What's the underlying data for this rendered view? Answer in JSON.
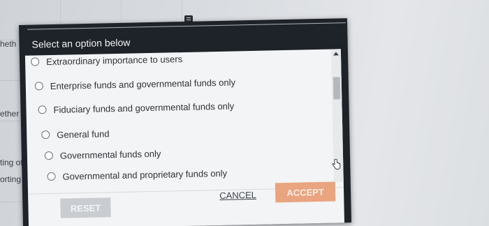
{
  "background": {
    "fragments": [
      "heth",
      "ether",
      "ting of",
      "orting"
    ]
  },
  "dialog": {
    "title": "Select an option below",
    "options": [
      {
        "label": "Extraordinary importance to users",
        "selected": false
      },
      {
        "label": "Enterprise funds and governmental funds only",
        "selected": false
      },
      {
        "label": "Fiduciary funds and governmental funds only",
        "selected": false
      },
      {
        "label": "General fund",
        "selected": false
      },
      {
        "label": "Governmental funds only",
        "selected": false
      },
      {
        "label": "Governmental and proprietary funds only",
        "selected": false
      }
    ],
    "buttons": {
      "reset": "RESET",
      "cancel": "CANCEL",
      "accept": "ACCEPT"
    }
  },
  "colors": {
    "dialog_header": "#1e2329",
    "accept_button": "#e9a480",
    "reset_button": "#c9cdd1"
  },
  "icons": [
    "toolbar-icon",
    "scroll-up-icon",
    "hand-cursor-icon"
  ]
}
